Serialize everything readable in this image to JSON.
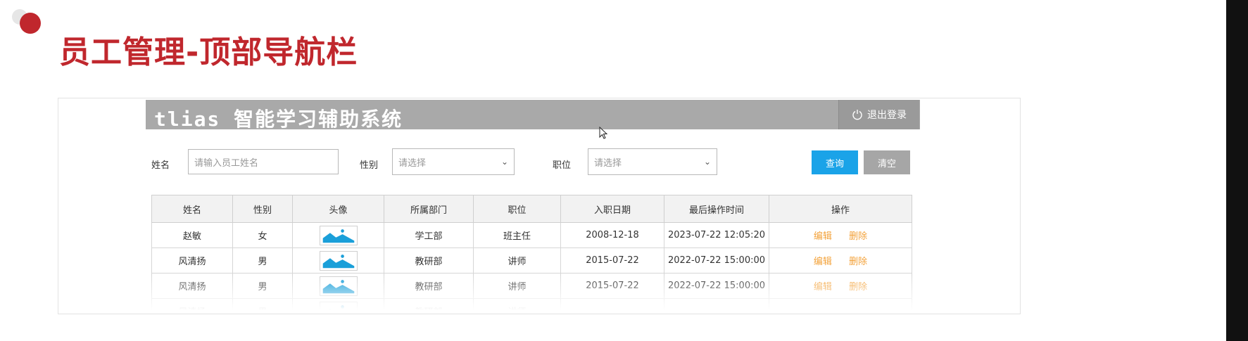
{
  "slide": {
    "title": "员工管理-顶部导航栏"
  },
  "app": {
    "title": "tlias 智能学习辅助系统",
    "logout_label": "退出登录"
  },
  "search": {
    "name_label": "姓名",
    "name_placeholder": "请输入员工姓名",
    "gender_label": "性别",
    "gender_value": "请选择",
    "job_label": "职位",
    "job_value": "请选择",
    "query_label": "查询",
    "clear_label": "清空"
  },
  "table": {
    "headers": [
      "姓名",
      "性别",
      "头像",
      "所属部门",
      "职位",
      "入职日期",
      "最后操作时间",
      "操作"
    ],
    "rows": [
      {
        "name": "赵敏",
        "gender": "女",
        "dept": "学工部",
        "job": "班主任",
        "entry": "2008-12-18",
        "updated": "2023-07-22 12:05:20",
        "edit": "编辑",
        "delete": "删除"
      },
      {
        "name": "风清扬",
        "gender": "男",
        "dept": "教研部",
        "job": "讲师",
        "entry": "2015-07-22",
        "updated": "2022-07-22 15:00:00",
        "edit": "编辑",
        "delete": "删除"
      },
      {
        "name": "风清扬",
        "gender": "男",
        "dept": "教研部",
        "job": "讲师",
        "entry": "2015-07-22",
        "updated": "2022-07-22 15:00:00",
        "edit": "编辑",
        "delete": "删除"
      },
      {
        "name": "风清扬",
        "gender": "男",
        "dept": "教研部",
        "job": "讲师",
        "entry": "",
        "updated": "",
        "edit": "",
        "delete": ""
      }
    ]
  },
  "colors": {
    "accent_red": "#c0272d",
    "primary_blue": "#1aa3e8",
    "link_orange": "#f3a23a",
    "header_grey": "#a9a9a9"
  },
  "icons": {
    "logout": "power-icon",
    "avatar": "image-placeholder-icon",
    "cursor": "mouse-pointer-icon"
  }
}
